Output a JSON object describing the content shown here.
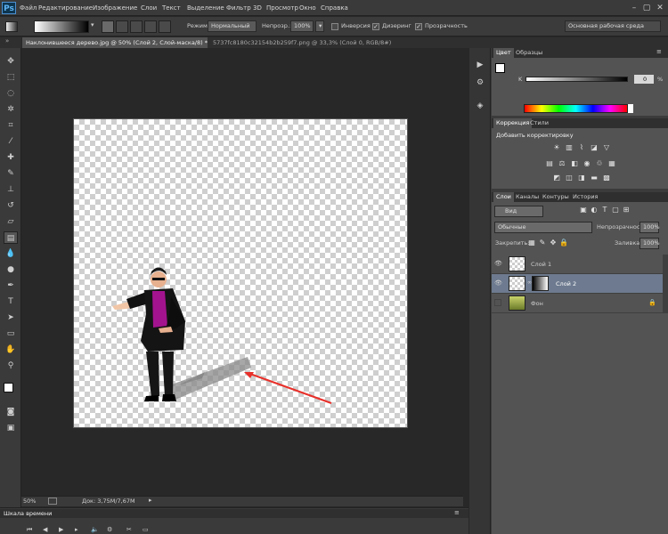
{
  "app": {
    "logo": "Ps"
  },
  "menu": [
    "Файл",
    "Редактирование",
    "Изображение",
    "Слои",
    "Текст",
    "Выделение",
    "Фильтр",
    "3D",
    "Просмотр",
    "Окно",
    "Справка"
  ],
  "options": {
    "mode_label": "Режим:",
    "mode_value": "Нормальный",
    "opacity_label": "Непрозр.:",
    "opacity_value": "100%",
    "inverse": "Инверсия",
    "dither": "Дизеринг",
    "transparency": "Прозрачность",
    "workspace": "Основная рабочая среда"
  },
  "doc_tabs": [
    "Наклонившееся дерево.jpg @ 50% (Слой 2, Слой-маска/8) *",
    "5737fc8180c32154b2b259f7.png @ 33,3% (Слой 0, RGB/8#)"
  ],
  "status": {
    "zoom": "50%",
    "doc": "Док: 3,75M/7,67M"
  },
  "timeline": {
    "label": "Шкала времени"
  },
  "color_panel": {
    "tabs": [
      "Цвет",
      "Образцы"
    ],
    "channel": "K",
    "value": "0",
    "unit": "%"
  },
  "adjust_panel": {
    "tabs": [
      "Коррекция",
      "Стили"
    ],
    "title": "Добавить корректировку"
  },
  "layers_panel": {
    "tabs": [
      "Слои",
      "Каналы",
      "Контуры",
      "История"
    ],
    "filter": "Вид",
    "blend": "Обычные",
    "opacity_label": "Непрозрачность:",
    "opacity_value": "100%",
    "lock_label": "Закрепить:",
    "fill_label": "Заливка:",
    "fill_value": "100%",
    "layers": [
      {
        "name": "Слой 1",
        "visible": true,
        "selected": false
      },
      {
        "name": "Слой 2",
        "visible": true,
        "selected": true
      },
      {
        "name": "Фон",
        "visible": false,
        "selected": false,
        "locked": true
      }
    ]
  },
  "colors": {
    "accent_selected_layer": "#6d7a8f",
    "arrow": "#e8302a",
    "shirt": "#a4138e"
  }
}
